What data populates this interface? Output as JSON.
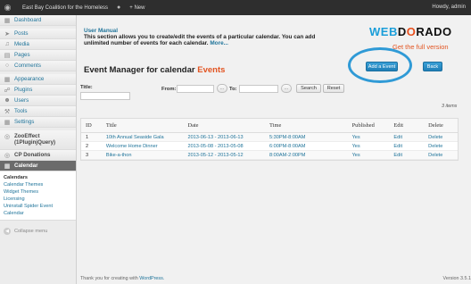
{
  "adminbar": {
    "site_name": "East Bay Coalition for the Homeless",
    "new_label": "+ New",
    "howdy": "Howdy, admin"
  },
  "sidebar": {
    "items": [
      {
        "label": "Dashboard",
        "icon": "dashboard-icon"
      },
      {
        "label": "Posts",
        "icon": "pin-icon"
      },
      {
        "label": "Media",
        "icon": "media-icon"
      },
      {
        "label": "Pages",
        "icon": "page-icon"
      },
      {
        "label": "Comments",
        "icon": "comment-icon"
      },
      {
        "label": "Appearance",
        "icon": "appearance-icon"
      },
      {
        "label": "Plugins",
        "icon": "plugin-icon"
      },
      {
        "label": "Users",
        "icon": "users-icon"
      },
      {
        "label": "Tools",
        "icon": "tools-icon"
      },
      {
        "label": "Settings",
        "icon": "settings-icon"
      },
      {
        "label": "ZooEffect (1PluginjQuery)",
        "icon": "zooeffect-icon"
      },
      {
        "label": "CP Donations",
        "icon": "donations-icon"
      },
      {
        "label": "Calendar",
        "icon": "calendar-icon"
      }
    ],
    "submenu": [
      "Calendars",
      "Calendar Themes",
      "Widget Themes",
      "Licensing",
      "Uninstall Spider Event Calendar"
    ],
    "collapse_label": "Collapse menu"
  },
  "intro": {
    "title": "User Manual",
    "text": "This section allows you to create/edit the events of a particular calendar. You can add unlimited number of events for each calendar.",
    "more": "More..."
  },
  "logo": {
    "part1": "W",
    "part2": "EB",
    "part3": "D",
    "part4": "O",
    "part5": "RADO",
    "full_version": "Get the full version"
  },
  "heading": {
    "main": "Event Manager for calendar",
    "accent": "Events"
  },
  "buttons": {
    "add_event": "Add a Event",
    "back": "Back",
    "search": "Search",
    "reset": "Reset",
    "dots": "..."
  },
  "filters": {
    "title_label": "Title:",
    "from_label": "From:",
    "to_label": "To:",
    "items_count": "3 items"
  },
  "table": {
    "headers": [
      "ID",
      "Title",
      "Date",
      "Time",
      "Published",
      "Edit",
      "Delete"
    ],
    "rows": [
      {
        "id": "1",
        "title": "10th Annual Seaside Gala",
        "date": "2013-06-13 - 2013-06-13",
        "time": "5:30PM-8:00AM",
        "published": "Yes",
        "edit": "Edit",
        "delete": "Delete"
      },
      {
        "id": "2",
        "title": "Welcome Home Dinner",
        "date": "2013-05-08 - 2013-05-08",
        "time": "6:00PM-8:00AM",
        "published": "Yes",
        "edit": "Edit",
        "delete": "Delete"
      },
      {
        "id": "3",
        "title": "Bike-a-thon",
        "date": "2013-05-12 - 2013-05-12",
        "time": "8:00AM-2:00PM",
        "published": "Yes",
        "edit": "Edit",
        "delete": "Delete"
      }
    ]
  },
  "footer": {
    "thanks_prefix": "Thank you for creating with ",
    "wordpress": "WordPress.",
    "version": "Version 3.5.1"
  },
  "colors": {
    "accent": "#e25421",
    "link": "#21759b",
    "button_blue": "#1f7fb8",
    "highlight_ring": "#2f9ad6"
  }
}
